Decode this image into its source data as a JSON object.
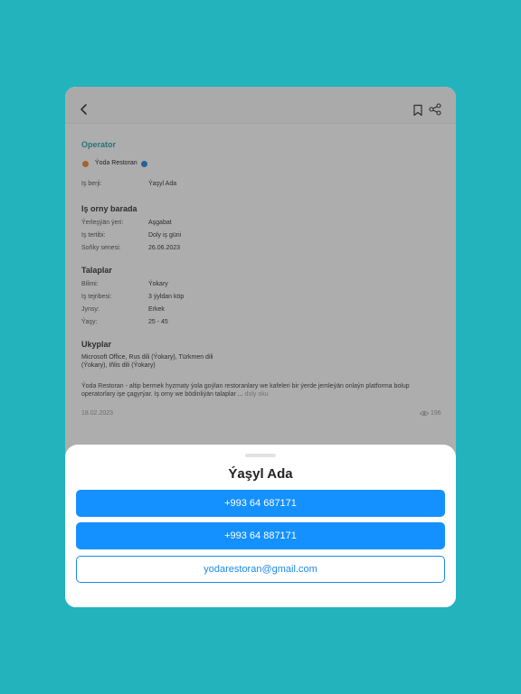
{
  "job": {
    "title": "Operator",
    "company": "Ýoda Restoran",
    "employer_label": "Iş berji:",
    "employer_value": "Ýaşyl Ada"
  },
  "about": {
    "heading": "Iş orny barada",
    "rows": [
      {
        "label": "Ýerleşýän ýeri:",
        "value": "Aşgabat"
      },
      {
        "label": "Iş tertibi:",
        "value": "Doly iş güni"
      },
      {
        "label": "Soňky senesi:",
        "value": "26.06.2023"
      }
    ]
  },
  "requirements": {
    "heading": "Talaplar",
    "rows": [
      {
        "label": "Bilimi:",
        "value": "Ýokary"
      },
      {
        "label": "Iş tejribesi:",
        "value": "3 ýyldan köp"
      },
      {
        "label": "Jynsy:",
        "value": "Erkek"
      },
      {
        "label": "Ýaşy:",
        "value": "25 - 45"
      }
    ]
  },
  "skills": {
    "heading": "Ukyplar",
    "line1": "Microsoft Office, Rus dili (Ýokary), Türkmen dili",
    "line2": "(Ýokary), Iňlis dili (Ýokary)"
  },
  "description": {
    "text": "Ýoda Restoran - altip bermek hyzmaty ýola goýlan restoranlary we kafeleri bir ýerde jemleýän onlaýn platforma bolup operatorlary işe çagyrýar. Iş orny we bödinliýän talaplar ...",
    "more": "doly oku"
  },
  "footer": {
    "date": "18.02.2023",
    "views": "196"
  },
  "sheet": {
    "title": "Ýaşyl Ada",
    "phone1": "+993 64 687171",
    "phone2": "+993 64 887171",
    "email": "yodarestoran@gmail.com"
  },
  "icons": {
    "back": "chevron-left-icon",
    "bookmark": "bookmark-icon",
    "share": "share-icon",
    "views": "eye-icon"
  },
  "colors": {
    "background": "#22b3bd",
    "accent": "#1591ff",
    "title": "#2aa3ad"
  }
}
